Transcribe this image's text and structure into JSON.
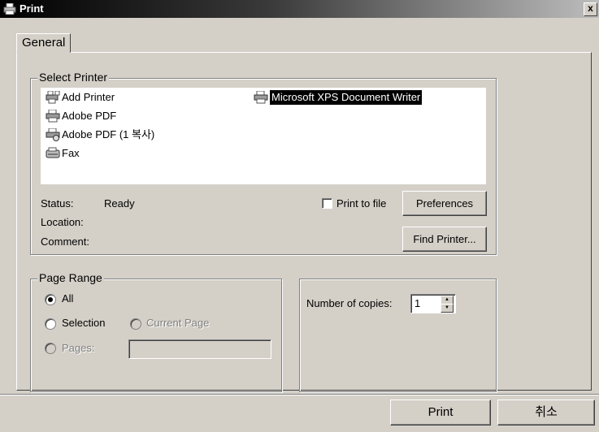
{
  "window": {
    "title": "Print",
    "close_glyph": "x"
  },
  "tabs": [
    {
      "label": "General"
    }
  ],
  "select_printer": {
    "legend": "Select Printer",
    "printers": [
      {
        "name": "Add Printer",
        "icon": "add-printer-icon"
      },
      {
        "name": "Adobe PDF",
        "icon": "printer-icon"
      },
      {
        "name": "Adobe PDF (1 복사)",
        "icon": "printer-icon"
      },
      {
        "name": "Fax",
        "icon": "fax-icon"
      },
      {
        "name": "Microsoft XPS Document Writer",
        "icon": "printer-icon",
        "selected": true
      }
    ],
    "status_label": "Status:",
    "status_value": "Ready",
    "location_label": "Location:",
    "comment_label": "Comment:",
    "print_to_file_label": "Print to file",
    "print_to_file_checked": false,
    "preferences_label": "Preferences",
    "find_printer_label": "Find Printer..."
  },
  "page_range": {
    "legend": "Page Range",
    "all_label": "All",
    "selection_label": "Selection",
    "current_page_label": "Current Page",
    "pages_label": "Pages:",
    "selected_option": "All"
  },
  "copies": {
    "label": "Number of copies:",
    "value": "1"
  },
  "buttons": {
    "print_label": "Print",
    "cancel_label": "취소"
  }
}
